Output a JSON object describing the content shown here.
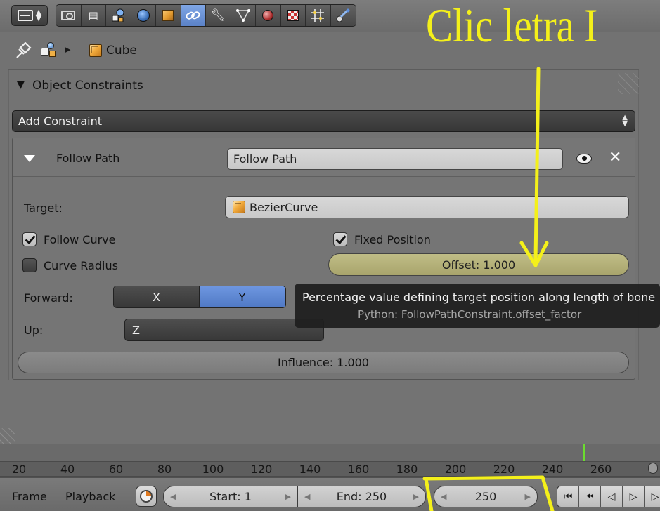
{
  "header": {
    "tabs": [
      {
        "name": "render",
        "icon": "camera-icon"
      },
      {
        "name": "render-layers",
        "icon": "render-layers-icon"
      },
      {
        "name": "scene",
        "icon": "scene-icon"
      },
      {
        "name": "world",
        "icon": "world-icon"
      },
      {
        "name": "object",
        "icon": "cube-icon"
      },
      {
        "name": "constraints",
        "icon": "link-icon",
        "active": true
      },
      {
        "name": "modifiers",
        "icon": "wrench-icon"
      },
      {
        "name": "data",
        "icon": "vertex-icon"
      },
      {
        "name": "material",
        "icon": "material-sphere-icon"
      },
      {
        "name": "texture",
        "icon": "checker-icon"
      },
      {
        "name": "particles",
        "icon": "particles-icon"
      },
      {
        "name": "physics",
        "icon": "physics-icon"
      }
    ]
  },
  "breadcrumb": {
    "object": "Cube"
  },
  "panel": {
    "title": "Object Constraints"
  },
  "add_constraint": {
    "label": "Add Constraint"
  },
  "constraint": {
    "type_label": "Follow Path",
    "name_value": "Follow Path",
    "target_label": "Target:",
    "target_value": "BezierCurve",
    "follow_curve": {
      "label": "Follow Curve",
      "checked": true
    },
    "curve_radius": {
      "label": "Curve Radius",
      "checked": false
    },
    "fixed_position": {
      "label": "Fixed Position",
      "checked": true
    },
    "offset_label": "Offset: 1.000",
    "forward_label": "Forward:",
    "forward_axes": [
      "X",
      "Y"
    ],
    "forward_active": "Y",
    "up_label": "Up:",
    "up_value": "Z",
    "influence_label": "Influence: 1.000"
  },
  "tooltip": {
    "description": "Percentage value defining target position along length of bone",
    "python": "Python: FollowPathConstraint.offset_factor"
  },
  "timeline": {
    "ticks": [
      "20",
      "40",
      "60",
      "80",
      "100",
      "120",
      "140",
      "160",
      "180",
      "200",
      "220",
      "240",
      "260"
    ]
  },
  "footer": {
    "menu_frame": "Frame",
    "menu_playback": "Playback",
    "start": "Start: 1",
    "end": "End: 250",
    "current": "250"
  },
  "annotation": {
    "text": "Clic letra I",
    "color": "#f4f01a"
  }
}
